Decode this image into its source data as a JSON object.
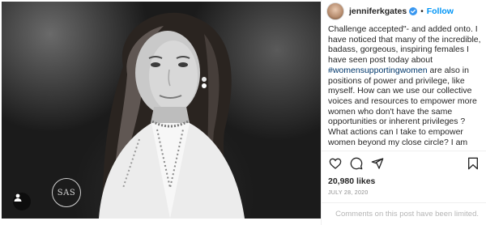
{
  "post": {
    "username": "jenniferkgates",
    "separator": "•",
    "follow_label": "Follow",
    "caption_parts": [
      "Challenge accepted\"- and added onto. I have noticed that many of the incredible, badass, gorgeous, inspiring females I have seen post today about ",
      "#womensupportingwomen",
      " are also in positions of power and privilege, like myself. How can we use our collective voices and resources to empower more women who don't have the same opportunities or inherent privileges ? What actions can I take to empower women beyond my close circle? I am reflecting on this tonight, and hope you'll join me. The answers will look"
    ],
    "likes": "20,980 likes",
    "date": "JULY 28, 2020",
    "comments_limited": "Comments on this post have been limited.",
    "watermark": "SAS",
    "icons": {
      "verified": "verified-badge-icon",
      "like": "heart-icon",
      "comment": "comment-icon",
      "share": "share-icon",
      "save": "bookmark-icon",
      "user_tag": "user-tag-icon"
    },
    "colors": {
      "follow": "#0095f6",
      "hashtag": "#00376b",
      "verified": "#3897f0",
      "muted": "#8e8e8e"
    }
  }
}
